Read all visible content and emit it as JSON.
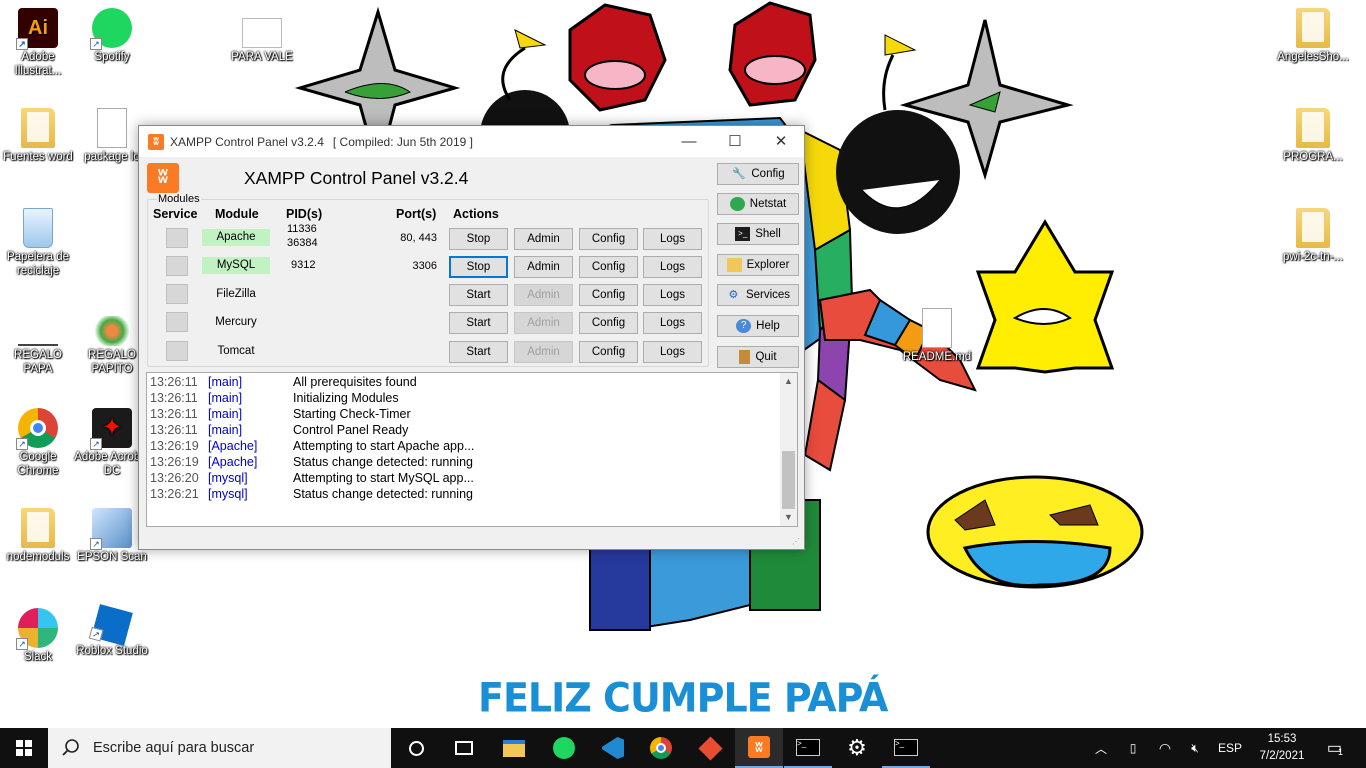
{
  "desktop": {
    "banner": "FELIZ CUMPLE PAPÁ",
    "icons": [
      {
        "label": "Adobe Illustrat..."
      },
      {
        "label": "Spotify"
      },
      {
        "label": "PARA VALE"
      },
      {
        "label": "AngelesSho..."
      },
      {
        "label": "Fuentes word"
      },
      {
        "label": "package lo"
      },
      {
        "label": "PROGRA..."
      },
      {
        "label": "Papelera de reciclaje"
      },
      {
        "label": "pwi-2c-tn-..."
      },
      {
        "label": "REGALO PAPA"
      },
      {
        "label": "REGALO PAPITO"
      },
      {
        "label": "README.md"
      },
      {
        "label": "Google Chrome"
      },
      {
        "label": "Adobe Acrobat DC"
      },
      {
        "label": "nodemoduls"
      },
      {
        "label": "EPSON Scan"
      },
      {
        "label": "Slack"
      },
      {
        "label": "Roblox Studio"
      }
    ]
  },
  "window": {
    "title": "XAMPP Control Panel v3.2.4",
    "compiled": "[ Compiled: Jun 5th 2019 ]",
    "header": "XAMPP Control Panel v3.2.4",
    "modules_label": "Modules",
    "columns": {
      "service": "Service",
      "module": "Module",
      "pids": "PID(s)",
      "ports": "Port(s)",
      "actions": "Actions"
    },
    "rows": [
      {
        "module": "Apache",
        "pid1": "11336",
        "pid2": "36384",
        "port": "80, 443",
        "action": "Stop",
        "admin": "Admin",
        "config": "Config",
        "logs": "Logs"
      },
      {
        "module": "MySQL",
        "pid1": "9312",
        "pid2": "",
        "port": "3306",
        "action": "Stop",
        "admin": "Admin",
        "config": "Config",
        "logs": "Logs"
      },
      {
        "module": "FileZilla",
        "pid1": "",
        "pid2": "",
        "port": "",
        "action": "Start",
        "admin": "Admin",
        "config": "Config",
        "logs": "Logs"
      },
      {
        "module": "Mercury",
        "pid1": "",
        "pid2": "",
        "port": "",
        "action": "Start",
        "admin": "Admin",
        "config": "Config",
        "logs": "Logs"
      },
      {
        "module": "Tomcat",
        "pid1": "",
        "pid2": "",
        "port": "",
        "action": "Start",
        "admin": "Admin",
        "config": "Config",
        "logs": "Logs"
      }
    ],
    "side_buttons": {
      "config": "Config",
      "netstat": "Netstat",
      "shell": "Shell",
      "explorer": "Explorer",
      "services": "Services",
      "help": "Help",
      "quit": "Quit"
    },
    "log": [
      {
        "time": "13:26:11",
        "module": "[main]",
        "msg": "All prerequisites found"
      },
      {
        "time": "13:26:11",
        "module": "[main]",
        "msg": "Initializing Modules"
      },
      {
        "time": "13:26:11",
        "module": "[main]",
        "msg": "Starting Check-Timer"
      },
      {
        "time": "13:26:11",
        "module": "[main]",
        "msg": "Control Panel Ready"
      },
      {
        "time": "13:26:19",
        "module": "[Apache]",
        "msg": "Attempting to start Apache app..."
      },
      {
        "time": "13:26:19",
        "module": "[Apache]",
        "msg": "Status change detected: running"
      },
      {
        "time": "13:26:20",
        "module": "[mysql]",
        "msg": "Attempting to start MySQL app..."
      },
      {
        "time": "13:26:21",
        "module": "[mysql]",
        "msg": "Status change detected: running"
      }
    ]
  },
  "taskbar": {
    "search_placeholder": "Escribe aquí para buscar",
    "language": "ESP",
    "time": "15:53",
    "date": "7/2/2021",
    "notifications": "1"
  },
  "colors": {
    "running_module_bg": "#c2f2c4",
    "xampp_orange": "#fb7a24",
    "banner_blue": "#1a8fd6"
  }
}
